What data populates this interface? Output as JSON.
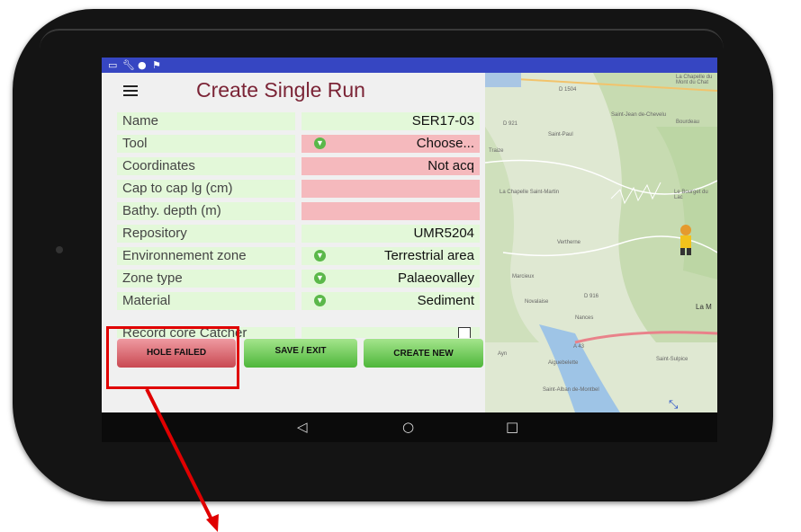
{
  "status_icons": [
    "window-icon",
    "wrench-icon",
    "globe-icon",
    "flag-icon"
  ],
  "app": {
    "title": "Create Single Run",
    "fields": [
      {
        "label": "Name",
        "value": "SER17-03",
        "style": "green"
      },
      {
        "label": "Tool",
        "value": "Choose...",
        "style": "red",
        "dropdown": true
      },
      {
        "label": "Coordinates",
        "value": "Not acq",
        "style": "red"
      },
      {
        "label": "Cap to cap lg (cm)",
        "value": "",
        "style": "red"
      },
      {
        "label": "Bathy. depth (m)",
        "value": "",
        "style": "red"
      },
      {
        "label": "Repository",
        "value": "UMR5204",
        "style": "green"
      },
      {
        "label": "Environnement zone",
        "value": "Terrestrial area",
        "style": "green",
        "dropdown": true
      },
      {
        "label": "Zone type",
        "value": "Palaeovalley",
        "style": "green",
        "dropdown": true
      },
      {
        "label": "Material",
        "value": "Sediment",
        "style": "green",
        "dropdown": true
      }
    ],
    "partial_field": {
      "label": "Record core Catcher",
      "checked": false
    },
    "buttons": {
      "hole_failed": "HOLE FAILED",
      "save_exit": "SAVE / EXIT",
      "create_new": "CREATE NEW"
    }
  },
  "map": {
    "labels": [
      "La Chapelle du Mont du Chat",
      "Saint-Jean de-Chevelu",
      "Bourdeau",
      "Saint-Paul",
      "Traize",
      "D 1504",
      "D 921",
      "La Chapelle Saint-Martin",
      "Le Bourget du Lac",
      "Vertherne",
      "Marcieux",
      "Nances",
      "Novalaise",
      "D 916",
      "A 43",
      "Ayn",
      "Saint-Sulpice",
      "Saint-Alban de-Montbel",
      "Aiguebelette",
      "La M"
    ]
  },
  "nav": {
    "back": "◁",
    "home": "○",
    "recent": "□"
  },
  "colors": {
    "statusbar": "#3646c2",
    "title": "#7b2436",
    "field_green": "#e3f8d9",
    "field_red": "#f5b9bd",
    "annotation": "#e00000"
  }
}
